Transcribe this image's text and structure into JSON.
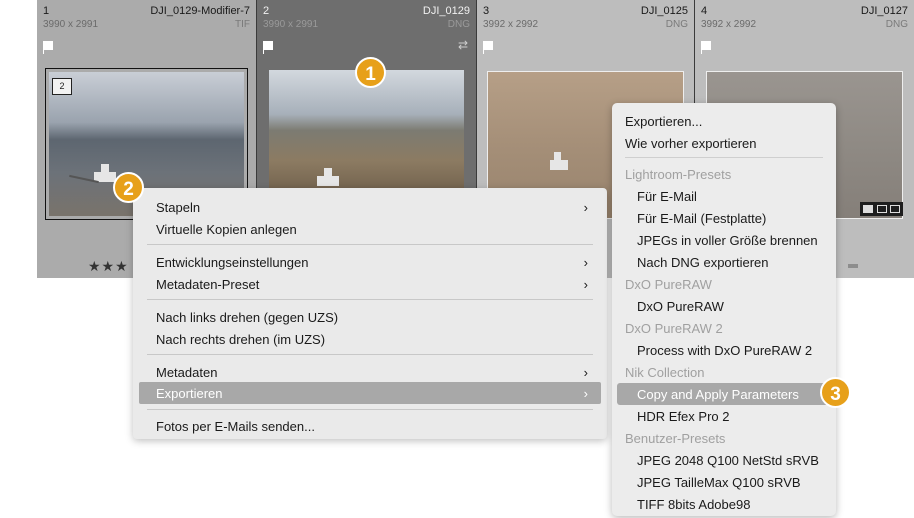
{
  "grid": {
    "cells": [
      {
        "index": "1",
        "filename": "DJI_0129-Modifier-7",
        "dimensions": "3990 x 2991",
        "filetype": "TIF",
        "stack_count": "2",
        "stars": "★★★"
      },
      {
        "index": "2",
        "filename": "DJI_0129",
        "dimensions": "3990 x 2991",
        "filetype": "DNG"
      },
      {
        "index": "3",
        "filename": "DJI_0125",
        "dimensions": "3992 x 2992",
        "filetype": "DNG"
      },
      {
        "index": "4",
        "filename": "DJI_0127",
        "dimensions": "3992 x 2992",
        "filetype": "DNG"
      }
    ],
    "sync_icon": "⇄"
  },
  "context_menu": {
    "items": [
      {
        "label": "Stapeln",
        "submenu": true
      },
      {
        "label": "Virtuelle Kopien anlegen"
      },
      {
        "label": "Entwicklungseinstellungen",
        "submenu": true
      },
      {
        "label": "Metadaten-Preset",
        "submenu": true
      },
      {
        "label": "Nach links drehen (gegen UZS)"
      },
      {
        "label": "Nach rechts drehen (im UZS)"
      },
      {
        "label": "Metadaten",
        "submenu": true
      },
      {
        "label": "Exportieren",
        "submenu": true,
        "highlighted": true
      },
      {
        "label": "Fotos per E-Mails senden..."
      }
    ],
    "arrow_glyph": "›"
  },
  "export_submenu": {
    "export": "Exportieren...",
    "export_previous": "Wie vorher exportieren",
    "groups": [
      {
        "label": "Lightroom-Presets",
        "items": [
          "Für E-Mail",
          "Für E-Mail (Festplatte)",
          "JPEGs in voller Größe brennen",
          "Nach DNG exportieren"
        ]
      },
      {
        "label": "DxO PureRAW",
        "items": [
          "DxO PureRAW"
        ]
      },
      {
        "label": "DxO PureRAW 2",
        "items": [
          "Process with DxO PureRAW 2"
        ]
      },
      {
        "label": "Nik Collection",
        "items": [
          "Copy and Apply Parameters",
          "HDR Efex Pro 2"
        ]
      },
      {
        "label": "Benutzer-Presets",
        "items": [
          "JPEG 2048 Q100 NetStd sRVB",
          "JPEG TailleMax Q100 sRVB",
          "TIFF 8bits Adobe98"
        ]
      }
    ],
    "highlighted_item": "Copy and Apply Parameters"
  },
  "callouts": [
    "1",
    "2",
    "3"
  ],
  "colors": {
    "callout": "#e7a01a",
    "highlight": "#a8a8a8"
  }
}
